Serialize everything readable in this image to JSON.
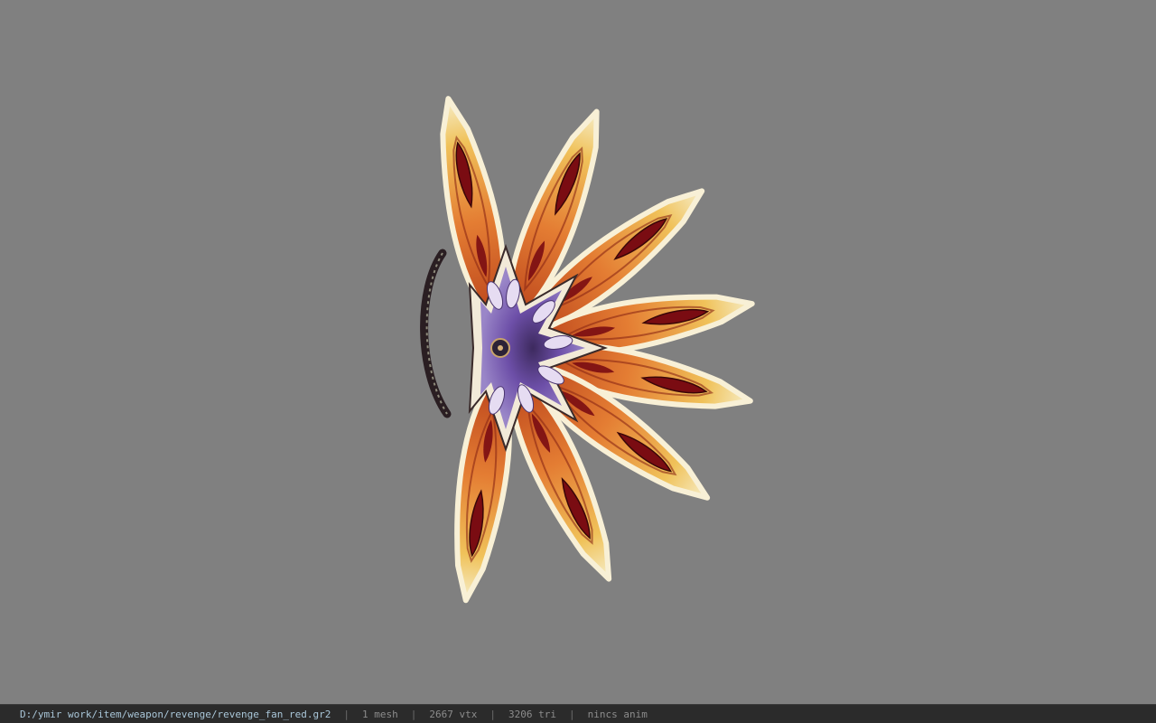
{
  "viewer": {
    "model_description": "red fan weapon model",
    "colors": {
      "background": "#808080",
      "petal_outer": "#f3e9b0",
      "petal_mid": "#e68a3a",
      "petal_inner": "#c24a1d",
      "petal_slit": "#7a0c12",
      "center_star": "#6b4aa0",
      "center_highlight": "#e6dcf2",
      "handle": "#2a1e22"
    }
  },
  "status": {
    "path": "D:/ymir work/item/weapon/revenge/revenge_fan_red.gr2",
    "sep": "|",
    "mesh": "1 mesh",
    "vtx": "2667 vtx",
    "tri": "3206 tri",
    "anim": "nincs anim"
  }
}
